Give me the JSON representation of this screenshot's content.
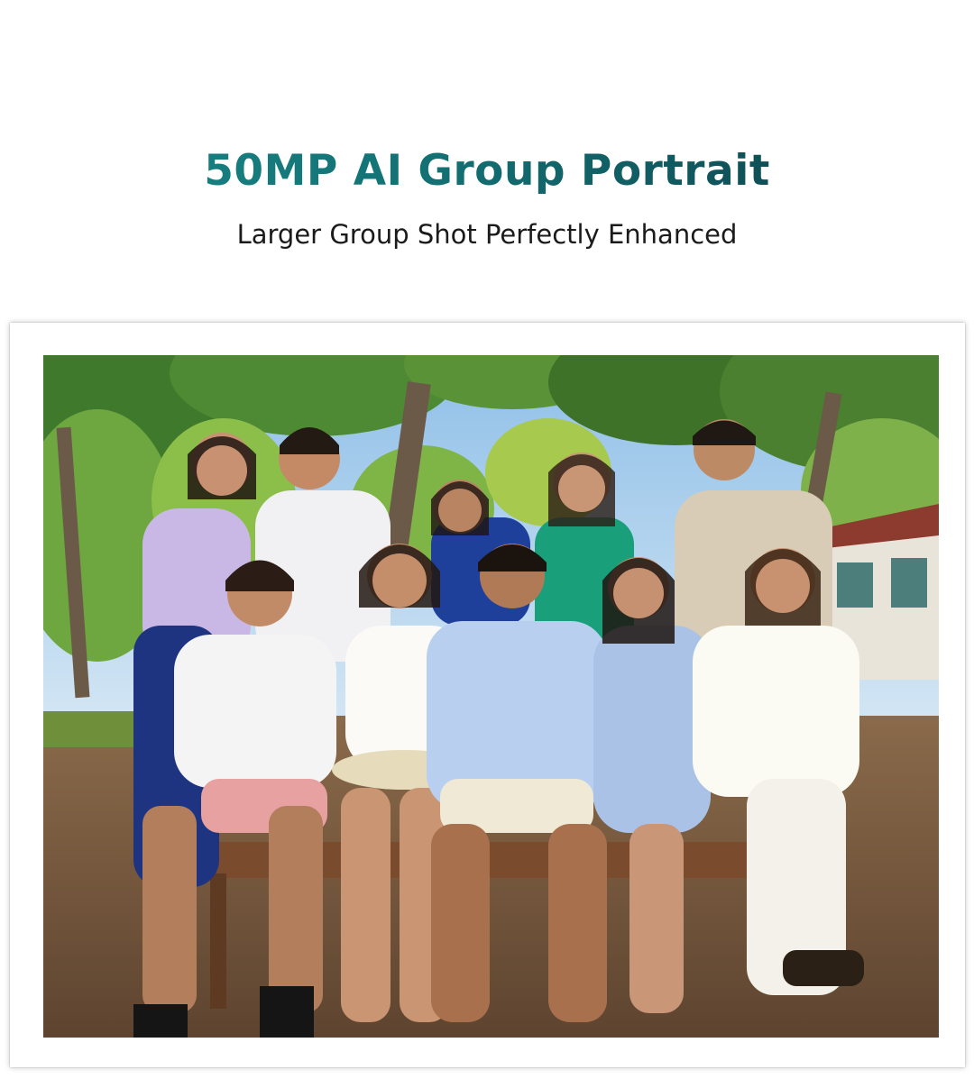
{
  "header": {
    "title": "50MP AI Group Portrait",
    "subtitle": "Larger Group Shot Perfectly Enhanced"
  },
  "photo": {
    "subject": "group-portrait-photo",
    "people_count": 10
  },
  "colors": {
    "title_gradient_start": "#1a8a8a",
    "title_gradient_end": "#0d3c46",
    "subtitle": "#1b1b1b",
    "background": "#ffffff"
  }
}
